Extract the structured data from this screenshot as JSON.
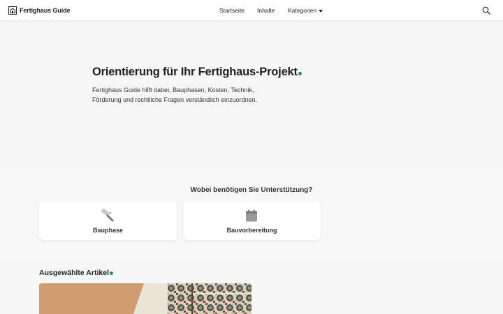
{
  "site": {
    "name": "Fertighaus Guide",
    "logo_icon": "house-icon"
  },
  "nav": {
    "items": [
      {
        "label": "Startseite"
      },
      {
        "label": "Inhalte"
      },
      {
        "label": "Kategorien",
        "icon": "chevron-down-icon"
      }
    ],
    "search_icon": "search-icon"
  },
  "hero": {
    "title": "Orientierung für Ihr Fertighaus-Projekt",
    "description": "Fertighaus Guide hilft dabei, Bauphasen, Kosten, Technik, Förderung und rechtliche Fragen verständlich einzuordnen."
  },
  "support": {
    "heading": "Wobei benötigen Sie Unterstützung?",
    "cards": [
      {
        "label": "Bauphase",
        "icon": "paint-roller-icon"
      },
      {
        "label": "Bauvorbereitung",
        "icon": "calendar-icon"
      }
    ]
  },
  "articles": {
    "heading": "Ausgewählte Artikel"
  },
  "colors": {
    "accent": "#1f8a7a",
    "background": "#f6f6f6",
    "header": "#ffffff"
  }
}
